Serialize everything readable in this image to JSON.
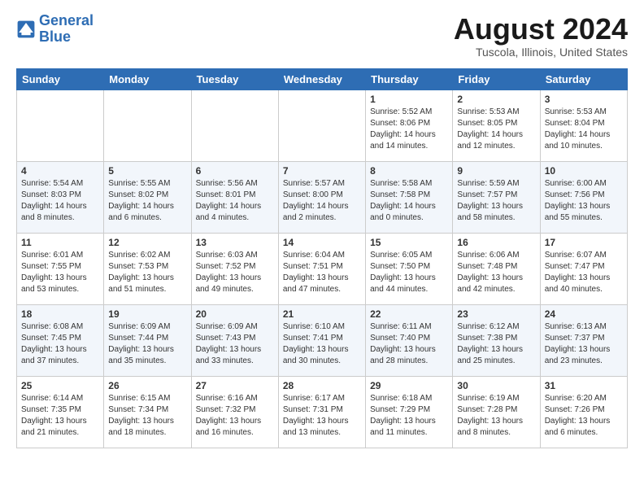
{
  "logo": {
    "line1": "General",
    "line2": "Blue"
  },
  "title": "August 2024",
  "location": "Tuscola, Illinois, United States",
  "days_of_week": [
    "Sunday",
    "Monday",
    "Tuesday",
    "Wednesday",
    "Thursday",
    "Friday",
    "Saturday"
  ],
  "weeks": [
    [
      {
        "day": "",
        "info": ""
      },
      {
        "day": "",
        "info": ""
      },
      {
        "day": "",
        "info": ""
      },
      {
        "day": "",
        "info": ""
      },
      {
        "day": "1",
        "info": "Sunrise: 5:52 AM\nSunset: 8:06 PM\nDaylight: 14 hours\nand 14 minutes."
      },
      {
        "day": "2",
        "info": "Sunrise: 5:53 AM\nSunset: 8:05 PM\nDaylight: 14 hours\nand 12 minutes."
      },
      {
        "day": "3",
        "info": "Sunrise: 5:53 AM\nSunset: 8:04 PM\nDaylight: 14 hours\nand 10 minutes."
      }
    ],
    [
      {
        "day": "4",
        "info": "Sunrise: 5:54 AM\nSunset: 8:03 PM\nDaylight: 14 hours\nand 8 minutes."
      },
      {
        "day": "5",
        "info": "Sunrise: 5:55 AM\nSunset: 8:02 PM\nDaylight: 14 hours\nand 6 minutes."
      },
      {
        "day": "6",
        "info": "Sunrise: 5:56 AM\nSunset: 8:01 PM\nDaylight: 14 hours\nand 4 minutes."
      },
      {
        "day": "7",
        "info": "Sunrise: 5:57 AM\nSunset: 8:00 PM\nDaylight: 14 hours\nand 2 minutes."
      },
      {
        "day": "8",
        "info": "Sunrise: 5:58 AM\nSunset: 7:58 PM\nDaylight: 14 hours\nand 0 minutes."
      },
      {
        "day": "9",
        "info": "Sunrise: 5:59 AM\nSunset: 7:57 PM\nDaylight: 13 hours\nand 58 minutes."
      },
      {
        "day": "10",
        "info": "Sunrise: 6:00 AM\nSunset: 7:56 PM\nDaylight: 13 hours\nand 55 minutes."
      }
    ],
    [
      {
        "day": "11",
        "info": "Sunrise: 6:01 AM\nSunset: 7:55 PM\nDaylight: 13 hours\nand 53 minutes."
      },
      {
        "day": "12",
        "info": "Sunrise: 6:02 AM\nSunset: 7:53 PM\nDaylight: 13 hours\nand 51 minutes."
      },
      {
        "day": "13",
        "info": "Sunrise: 6:03 AM\nSunset: 7:52 PM\nDaylight: 13 hours\nand 49 minutes."
      },
      {
        "day": "14",
        "info": "Sunrise: 6:04 AM\nSunset: 7:51 PM\nDaylight: 13 hours\nand 47 minutes."
      },
      {
        "day": "15",
        "info": "Sunrise: 6:05 AM\nSunset: 7:50 PM\nDaylight: 13 hours\nand 44 minutes."
      },
      {
        "day": "16",
        "info": "Sunrise: 6:06 AM\nSunset: 7:48 PM\nDaylight: 13 hours\nand 42 minutes."
      },
      {
        "day": "17",
        "info": "Sunrise: 6:07 AM\nSunset: 7:47 PM\nDaylight: 13 hours\nand 40 minutes."
      }
    ],
    [
      {
        "day": "18",
        "info": "Sunrise: 6:08 AM\nSunset: 7:45 PM\nDaylight: 13 hours\nand 37 minutes."
      },
      {
        "day": "19",
        "info": "Sunrise: 6:09 AM\nSunset: 7:44 PM\nDaylight: 13 hours\nand 35 minutes."
      },
      {
        "day": "20",
        "info": "Sunrise: 6:09 AM\nSunset: 7:43 PM\nDaylight: 13 hours\nand 33 minutes."
      },
      {
        "day": "21",
        "info": "Sunrise: 6:10 AM\nSunset: 7:41 PM\nDaylight: 13 hours\nand 30 minutes."
      },
      {
        "day": "22",
        "info": "Sunrise: 6:11 AM\nSunset: 7:40 PM\nDaylight: 13 hours\nand 28 minutes."
      },
      {
        "day": "23",
        "info": "Sunrise: 6:12 AM\nSunset: 7:38 PM\nDaylight: 13 hours\nand 25 minutes."
      },
      {
        "day": "24",
        "info": "Sunrise: 6:13 AM\nSunset: 7:37 PM\nDaylight: 13 hours\nand 23 minutes."
      }
    ],
    [
      {
        "day": "25",
        "info": "Sunrise: 6:14 AM\nSunset: 7:35 PM\nDaylight: 13 hours\nand 21 minutes."
      },
      {
        "day": "26",
        "info": "Sunrise: 6:15 AM\nSunset: 7:34 PM\nDaylight: 13 hours\nand 18 minutes."
      },
      {
        "day": "27",
        "info": "Sunrise: 6:16 AM\nSunset: 7:32 PM\nDaylight: 13 hours\nand 16 minutes."
      },
      {
        "day": "28",
        "info": "Sunrise: 6:17 AM\nSunset: 7:31 PM\nDaylight: 13 hours\nand 13 minutes."
      },
      {
        "day": "29",
        "info": "Sunrise: 6:18 AM\nSunset: 7:29 PM\nDaylight: 13 hours\nand 11 minutes."
      },
      {
        "day": "30",
        "info": "Sunrise: 6:19 AM\nSunset: 7:28 PM\nDaylight: 13 hours\nand 8 minutes."
      },
      {
        "day": "31",
        "info": "Sunrise: 6:20 AM\nSunset: 7:26 PM\nDaylight: 13 hours\nand 6 minutes."
      }
    ]
  ]
}
